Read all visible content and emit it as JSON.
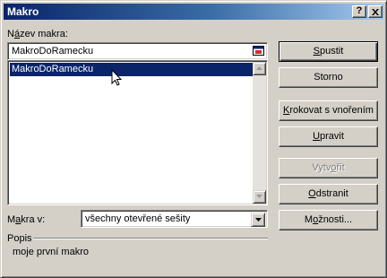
{
  "window": {
    "title": "Makro",
    "help_label": "?",
    "close_label": "X"
  },
  "macro_name": {
    "label_prefix": "N",
    "label_hotkey": "á",
    "label_suffix": "zev makra:",
    "value": "MakroDoRamecku"
  },
  "macro_list": {
    "items": [
      {
        "label": "MakroDoRamecku",
        "selected": true
      }
    ]
  },
  "macros_in": {
    "label_prefix": "M",
    "label_hotkey": "a",
    "label_suffix": "kra v:",
    "selected": "všechny otevřené sešity"
  },
  "description": {
    "label": "Popis",
    "text": "moje první makro"
  },
  "buttons": {
    "run": {
      "hotkey": "S",
      "rest": "pustit"
    },
    "cancel": {
      "label": "Storno"
    },
    "step_into": {
      "hotkey": "K",
      "rest": "rokovat s vnořením"
    },
    "edit": {
      "hotkey": "U",
      "rest": "pravit"
    },
    "create": {
      "prefix": "Vytv",
      "hotkey": "o",
      "rest": "řit"
    },
    "delete": {
      "hotkey": "O",
      "rest": "dstranit"
    },
    "options": {
      "prefix": "M",
      "hotkey": "o",
      "rest": "žnosti..."
    }
  },
  "colors": {
    "selection": "#0a246a",
    "title_gradient_start": "#0a246a",
    "title_gradient_end": "#a6caf0",
    "face": "#d4d0c8"
  }
}
